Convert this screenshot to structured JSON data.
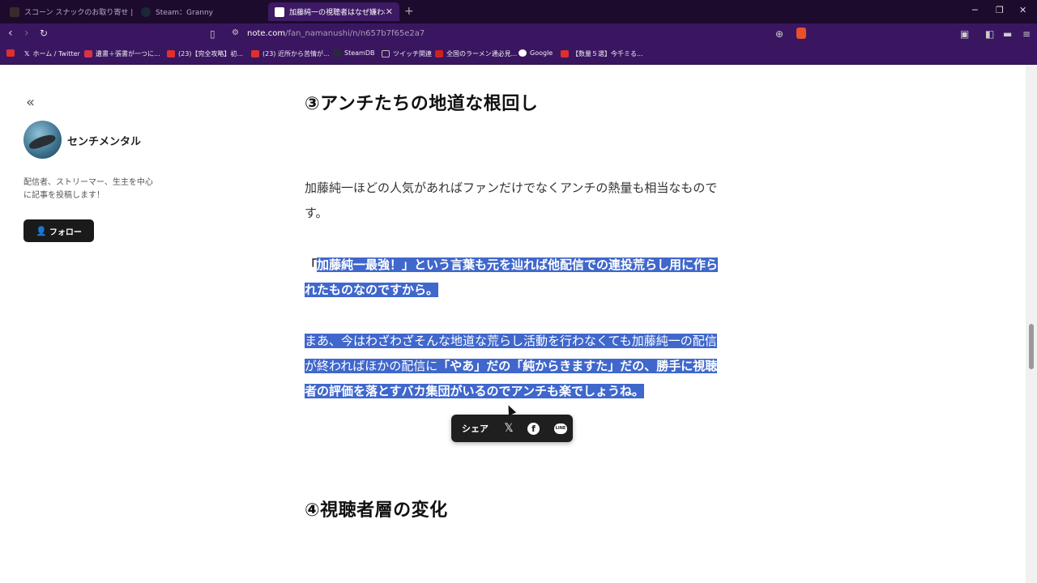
{
  "browser": {
    "tabs": [
      {
        "title": "スコーン スナックのお取り寄せ | 公式通販",
        "active": false
      },
      {
        "title": "Steam：Granny",
        "active": false
      },
      {
        "title": "加藤純一の視聴者はなぜ嫌われて",
        "active": true
      }
    ],
    "url_host": "note.com",
    "url_path": "/fan_namanushi/n/n657b7f65e2a7",
    "bookmarks": [
      {
        "label": "",
        "color": "#e0302c"
      },
      {
        "label": "ホーム / Twitter",
        "color": "#222222"
      },
      {
        "label": "遺書＋張書が一つに...",
        "color": "#d9334a"
      },
      {
        "label": "(23)【完全攻略】初...",
        "color": "#e0302c"
      },
      {
        "label": "(23) 近所から苦情が...",
        "color": "#e0302c"
      },
      {
        "label": "SteamDB",
        "color": "#2a2a3a"
      },
      {
        "label": "ツイッチ関連",
        "color": "#bbbbbb"
      },
      {
        "label": "全国のラーメン通必見...",
        "color": "#cc2222"
      },
      {
        "label": "Google",
        "color": "#ffffff"
      },
      {
        "label": "【数量５選】今千ミる...",
        "color": "#e0302c"
      }
    ]
  },
  "sidebar": {
    "author_name": "センチメンタル",
    "bio": "配信者、ストリーマー、生主を中心に記事を投稿します！",
    "follow_label": "フォロー"
  },
  "article": {
    "heading3": "③アンチたちの地道な根回し",
    "p1": "加藤純一ほどの人気があればファンだけでなくアンチの熱量も相当なものです。",
    "p2_lead": "「",
    "p2_sel": "加藤純一最強！」という言葉も元を辿れば他配信での連投荒らし用に作られたものなのですから。",
    "p3_plain": "まあ、今はわざわざそんな地道な荒らし活動を行わなくても加藤純一の配信が終わればほかの配信に",
    "p3_bold": "「やあ」だの「純からきますた」だの、勝手に視聴者の評価を落とすバカ集団がいるのでアンチも楽でしょうね。",
    "heading4": "④視聴者層の変化"
  },
  "share": {
    "label": "シェア"
  }
}
